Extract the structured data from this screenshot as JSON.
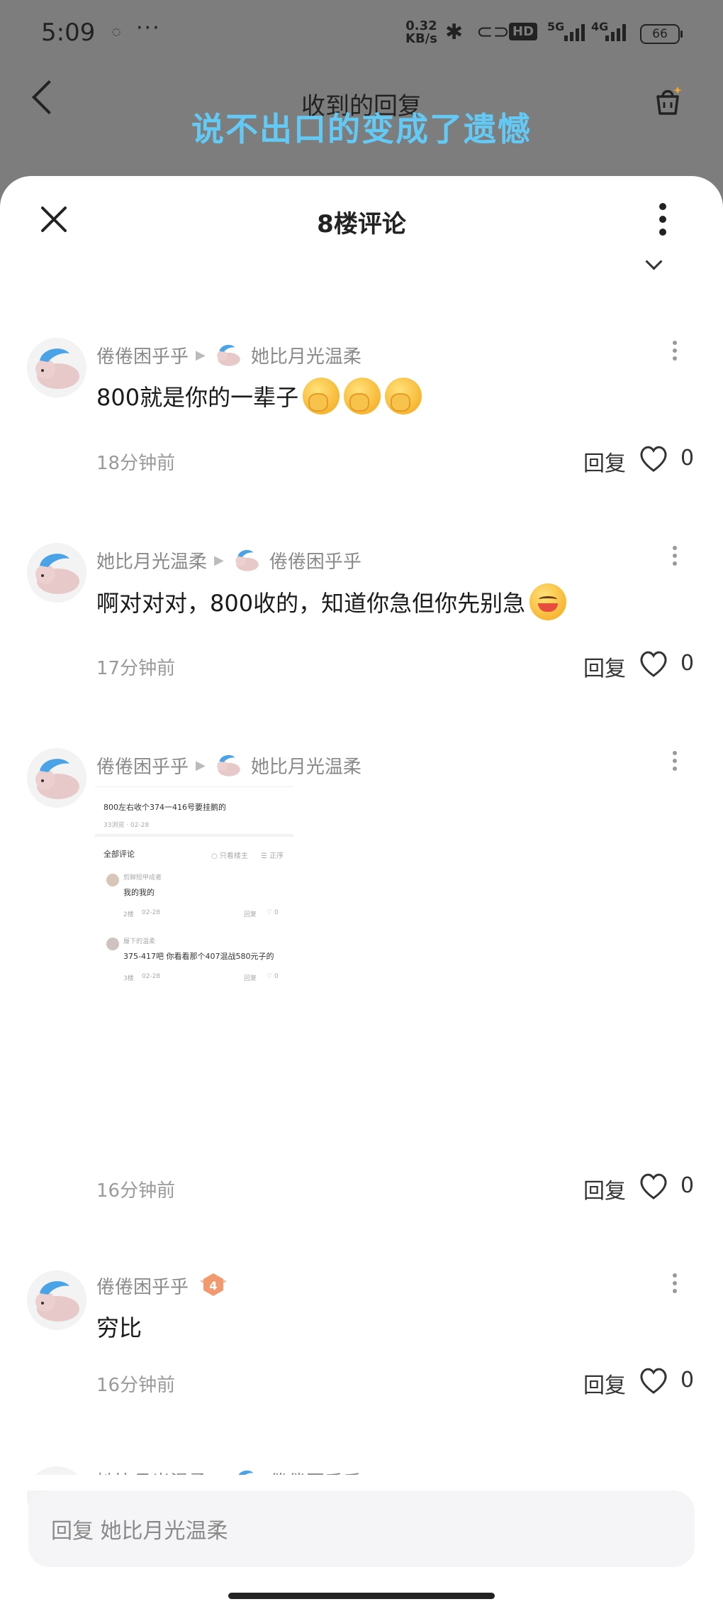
{
  "status_bar": {
    "time": "5:09",
    "speed_value": "0.32",
    "speed_unit": "KB/s",
    "hd": "HD",
    "net1": "5G",
    "net2": "4G",
    "battery": "66"
  },
  "header": {
    "back_icon": "chevron-left-icon",
    "title": "收到的回复",
    "cart_icon": "shopping-basket-icon"
  },
  "overlay_caption": "说不出口的变成了遗憾",
  "sheet": {
    "title": "8楼评论",
    "close_icon": "close-icon",
    "more_icon": "more-vertical-icon"
  },
  "comments": [
    {
      "author": "倦倦困乎乎",
      "reply_to": "她比月光温柔",
      "text": "800就是你的一辈子",
      "emojis": [
        "yawn",
        "yawn",
        "yawn"
      ],
      "time": "18分钟前",
      "reply_label": "回复",
      "likes": "0"
    },
    {
      "author": "她比月光温柔",
      "reply_to": "倦倦困乎乎",
      "text": "啊对对对，800收的，知道你急但你先别急",
      "emojis": [
        "grin"
      ],
      "time": "17分钟前",
      "reply_label": "回复",
      "likes": "0"
    },
    {
      "author": "倦倦困乎乎",
      "reply_to": "她比月光温柔",
      "image": {
        "post_text": "800左右收个374一416号要挂鹅的",
        "post_meta": "33浏览 · 02-28",
        "section_title": "全部评论",
        "filter_label": "只看楼主",
        "sort_label": "正序",
        "items": [
          {
            "user": "剪脚短甲成者",
            "text": "我的我的",
            "floor": "2楼",
            "date": "02-28",
            "reply": "回复",
            "likes": "0"
          },
          {
            "user": "履下的温柔",
            "text": "375-417吧 你看看那个407混战580元子的",
            "floor": "3楼",
            "date": "02-28",
            "reply": "回复",
            "likes": "0"
          }
        ]
      },
      "time": "16分钟前",
      "reply_label": "回复",
      "likes": "0"
    },
    {
      "author": "倦倦困乎乎",
      "level": "4",
      "text": "穷比",
      "time": "16分钟前",
      "reply_label": "回复",
      "likes": "0"
    },
    {
      "author": "她比月光温柔",
      "reply_to": "倦倦困乎乎"
    }
  ],
  "input": {
    "placeholder": "回复 她比月光温柔"
  }
}
